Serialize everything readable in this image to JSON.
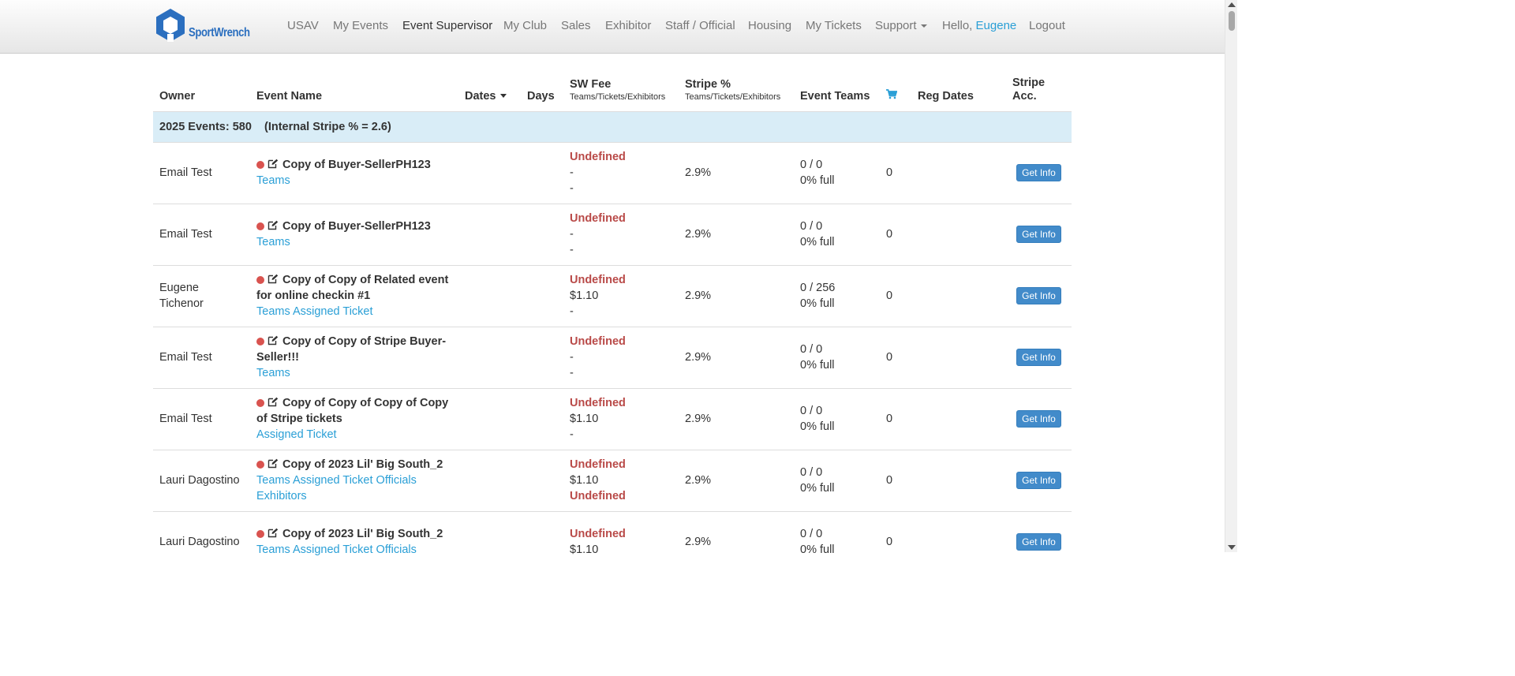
{
  "nav": {
    "logo_text": "SportWrench",
    "items": [
      "USAV",
      "My Events",
      "Event Supervisor",
      "My Club",
      "Sales",
      "Exhibitor",
      "Staff / Official",
      "Housing",
      "My Tickets",
      "Support"
    ],
    "greeting": "Hello,",
    "user": "Eugene",
    "logout": "Logout"
  },
  "table": {
    "headers": {
      "owner": "Owner",
      "event_name": "Event Name",
      "dates": "Dates",
      "days": "Days",
      "sw_fee": "SW Fee",
      "sw_fee_sub": "Teams/Tickets/Exhibitors",
      "stripe": "Stripe %",
      "stripe_sub": "Teams/Tickets/Exhibitors",
      "event_teams": "Event Teams",
      "cart_icon": "shopping-cart-icon",
      "reg_dates": "Reg Dates",
      "stripe_acc": "Stripe Acc."
    },
    "group_label": "2025 Events: 580",
    "group_note": "(Internal Stripe % = 2.6)",
    "button_label": "Get Info",
    "rows": [
      {
        "owner": "Email Test",
        "title": "Copy of Buyer-SellerPH123",
        "links": [
          "Teams"
        ],
        "fees": [
          "Undefined",
          "-",
          "-"
        ],
        "stripe": "2.9%",
        "teams": "0 / 0",
        "full": "0% full",
        "cart": "0"
      },
      {
        "owner": "Email Test",
        "title": "Copy of Buyer-SellerPH123",
        "links": [
          "Teams"
        ],
        "fees": [
          "Undefined",
          "-",
          "-"
        ],
        "stripe": "2.9%",
        "teams": "0 / 0",
        "full": "0% full",
        "cart": "0"
      },
      {
        "owner": "Eugene Tichenor",
        "title": "Copy of Copy of Related event for online checkin #1",
        "links": [
          "Teams",
          "Assigned Ticket"
        ],
        "fees": [
          "Undefined",
          "$1.10",
          "-"
        ],
        "stripe": "2.9%",
        "teams": "0 / 256",
        "full": "0% full",
        "cart": "0"
      },
      {
        "owner": "Email Test",
        "title": "Copy of Copy of Stripe Buyer-Seller!!!",
        "links": [
          "Teams"
        ],
        "fees": [
          "Undefined",
          "-",
          "-"
        ],
        "stripe": "2.9%",
        "teams": "0 / 0",
        "full": "0% full",
        "cart": "0"
      },
      {
        "owner": "Email Test",
        "title": "Copy of Copy of Copy of Copy of Stripe tickets",
        "links": [
          "Assigned Ticket"
        ],
        "fees": [
          "Undefined",
          "$1.10",
          "-"
        ],
        "stripe": "2.9%",
        "teams": "0 / 0",
        "full": "0% full",
        "cart": "0"
      },
      {
        "owner": "Lauri Dagostino",
        "title": "Copy of 2023 Lil' Big South_2",
        "links": [
          "Teams",
          "Assigned Ticket",
          "Officials",
          "Exhibitors"
        ],
        "fees": [
          "Undefined",
          "$1.10",
          "Undefined"
        ],
        "stripe": "2.9%",
        "teams": "0 / 0",
        "full": "0% full",
        "cart": "0"
      },
      {
        "owner": "Lauri Dagostino",
        "title": "Copy of 2023 Lil' Big South_2",
        "links": [
          "Teams",
          "Assigned Ticket",
          "Officials"
        ],
        "fees": [
          "Undefined",
          "$1.10",
          ""
        ],
        "stripe": "2.9%",
        "teams": "0 / 0",
        "full": "0% full",
        "cart": "0"
      }
    ]
  }
}
